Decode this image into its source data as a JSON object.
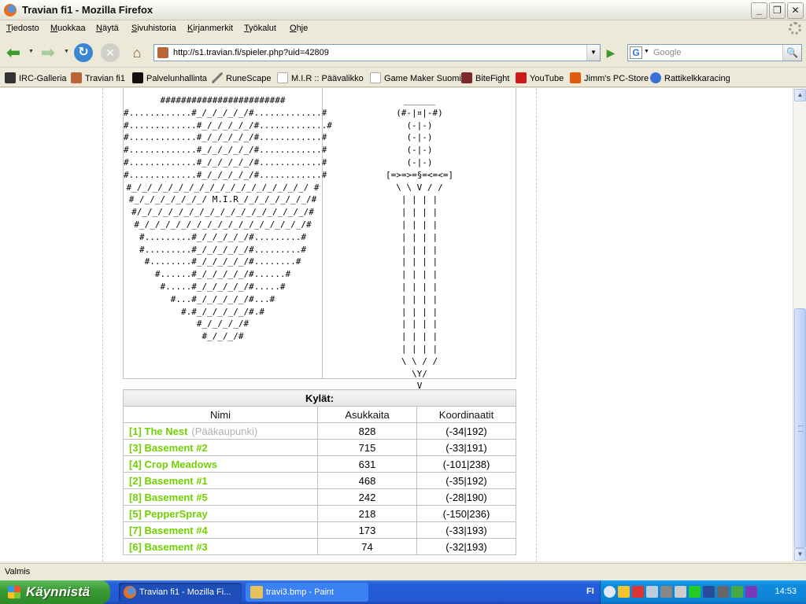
{
  "window": {
    "title": "Travian fi1 - Mozilla Firefox"
  },
  "menu": [
    "Tiedosto",
    "Muokkaa",
    "Näytä",
    "Sivuhistoria",
    "Kirjanmerkit",
    "Työkalut",
    "Ohje"
  ],
  "nav": {
    "url": "http://s1.travian.fi/spieler.php?uid=42809",
    "search_placeholder": "Google"
  },
  "bookmarks": [
    "IRC-Galleria",
    "Travian fi1",
    "Palvelunhallinta",
    "RuneScape",
    "M.I.R :: Päävalikko",
    "Game Maker Suomi",
    "BiteFight",
    "YouTube",
    "Jimm's PC-Store",
    "Rattikelkkaracing"
  ],
  "profile": {
    "shield_art": "########################\n#............#_/_/_/_/_/#.............#\n#.............#_/_/_/_/_/#.............#\n#.............#_/_/_/_/_/#............#\n#.............#_/_/_/_/_/#............#\n#.............#_/_/_/_/_/#............#\n#.............#_/_/_/_/_/#............#\n#_/_/_/_/_/_/_/_/_/_/_/_/_/_/_/_/_/ #\n#_/_/_/_/_/_/_/ M.I.R_/_/_/_/_/_/_/#\n#/_/_/_/_/_/_/_/_/_/_/_/_/_/_/_/_/#\n#_/_/_/_/_/_/_/_/_/_/_/_/_/_/_/_/#\n#.........#_/_/_/_/_/#.........#\n#.........#_/_/_/_/_/#.........#\n#........#_/_/_/_/_/#........#\n#......#_/_/_/_/_/#......#\n#.....#_/_/_/_/_/#.....#\n#...#_/_/_/_/_/#...#\n#.#_/_/_/_/_/#.#\n#_/_/_/_/#\n#_/_/_/#",
    "sword_art": "______\n(#-|¤|-#)\n(-|-)\n(-|-)\n(-|-)\n(-|-)\n[=>=>=§=<=<=]\n\\ \\ V / /\n| | | |\n| | | |\n| | | |\n| | | |\n| | | |\n| | | |\n| | | |\n| | | |\n| | | |\n| | | |\n| | | |\n| | | |\n| | | |\n\\ \\ / /\n\\Y/\nV"
  },
  "villages": {
    "caption": "Kylät:",
    "headers": {
      "name": "Nimi",
      "pop": "Asukkaita",
      "coords": "Koordinaatit"
    },
    "capital_label": "(Pääkaupunki)",
    "rows": [
      {
        "name": "[1] The Nest",
        "capital": true,
        "pop": "828",
        "coords": "(-34|192)"
      },
      {
        "name": "[3] Basement #2",
        "capital": false,
        "pop": "715",
        "coords": "(-33|191)"
      },
      {
        "name": "[4] Crop Meadows",
        "capital": false,
        "pop": "631",
        "coords": "(-101|238)"
      },
      {
        "name": "[2] Basement #1",
        "capital": false,
        "pop": "468",
        "coords": "(-35|192)"
      },
      {
        "name": "[8] Basement #5",
        "capital": false,
        "pop": "242",
        "coords": "(-28|190)"
      },
      {
        "name": "[5] PepperSpray",
        "capital": false,
        "pop": "218",
        "coords": "(-150|236)"
      },
      {
        "name": "[7] Basement #4",
        "capital": false,
        "pop": "173",
        "coords": "(-33|193)"
      },
      {
        "name": "[6] Basement #3",
        "capital": false,
        "pop": "74",
        "coords": "(-32|193)"
      }
    ]
  },
  "status": {
    "text": "Valmis"
  },
  "taskbar": {
    "start_label": "Käynnistä",
    "tasks": [
      "Travian fi1 - Mozilla Fi...",
      "travi3.bmp - Paint"
    ],
    "lang": "FI",
    "clock": "14:53"
  },
  "colors": {
    "village_link": "#71d000",
    "taskbar_blue": "#245edc",
    "start_green": "#3c9c36"
  }
}
